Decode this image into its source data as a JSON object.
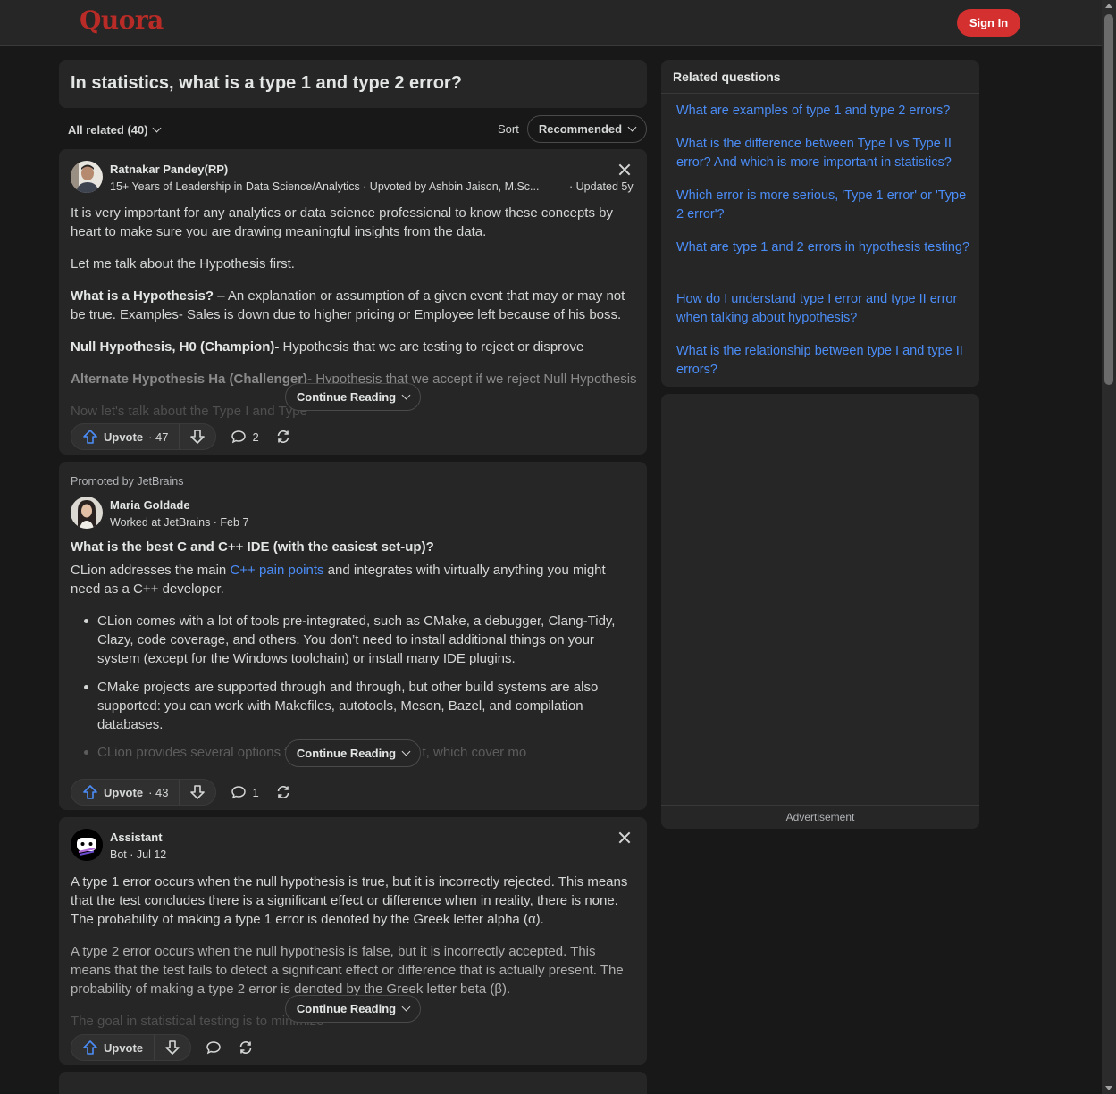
{
  "header": {
    "logo": "Quora",
    "sign_in": "Sign In"
  },
  "question": {
    "title": "In statistics, what is a type 1 and type 2 error?"
  },
  "filters": {
    "all_related": "All related (40)",
    "sort_label": "Sort",
    "sort_value": "Recommended"
  },
  "answers": [
    {
      "author": "Ratnakar Pandey(RP)",
      "credential": "15+ Years of Leadership in Data Science/Analytics · Upvoted by Ashbin Jaison, M.Sc...",
      "updated": "· Updated 5y",
      "p1": "It is very important for any analytics or data science professional to know these concepts by heart to make sure you are drawing meaningful insights from the data.",
      "p2": "Let me talk about the Hypothesis first.",
      "p3_bold": "What is a Hypothesis?",
      "p3_rest": " – An explanation or assumption of a given event that may or may not be true. Examples- Sales is down due to higher pricing or Employee left because of his boss.",
      "p4_bold": "Null Hypothesis, H0 (Champion)-",
      "p4_rest": " Hypothesis that we are testing to reject or disprove",
      "p5_bold": "Alternate Hypothesis Ha (Challenger)",
      "p5_rest": "- Hypothesis that we accept if we reject Null Hypothesis",
      "p6": "Now let's talk about the Type I and Type",
      "continue": "Continue Reading",
      "upvote": "Upvote",
      "upvote_count": "· 47",
      "comments": "2"
    },
    {
      "promoted": "Promoted by JetBrains",
      "author": "Maria Goldade",
      "credential": "Worked at JetBrains · Feb 7",
      "title": "What is the best C and C++ IDE (with the easiest set-up)?",
      "p1_pre": "CLion addresses the main ",
      "p1_link": "C++ pain points",
      "p1_post": " and integrates with virtually anything you might need as a C++ developer.",
      "b1": "CLion comes with a lot of tools pre-integrated, such as CMake, a debugger, Clang-Tidy, Clazy, code coverage, and others. You don’t need to install additional things on your system (except for the Windows toolchain) or install many IDE plugins.",
      "b2": "CMake projects are supported through and through, but other build systems are also supported: you can work with Makefiles, autotools, Meson, Bazel, and compilation databases.",
      "b3": "CLion provides several options f                                    t, which cover mo",
      "continue": "Continue Reading",
      "upvote": "Upvote",
      "upvote_count": "· 43",
      "comments": "1"
    },
    {
      "author": "Assistant",
      "credential": "Bot · Jul 12",
      "p1": "A type 1 error occurs when the null hypothesis is true, but it is incorrectly rejected. This means that the test concludes there is a significant effect or difference when in reality, there is none. The probability of making a type 1 error is denoted by the Greek letter alpha (α).",
      "p2": "A type 2 error occurs when the null hypothesis is false, but it is incorrectly accepted. This means that the test fails to detect a significant effect or difference that is actually present. The probability of making a type 2 error is denoted by the Greek letter beta (β).",
      "p3": "The goal in statistical testing is to minimize",
      "continue": "Continue Reading",
      "upvote": "Upvote"
    }
  ],
  "sidebar": {
    "heading": "Related questions",
    "links": [
      "What are examples of type 1 and type 2 errors?",
      "What is the difference between Type I vs Type II error? And which is more important in statistics?",
      "Which error is more serious, 'Type 1 error' or 'Type 2 error'?",
      "What are type 1 and 2 errors in hypothesis testing?",
      "How do I understand type I error and type II error when talking about hypothesis?",
      "What is the relationship between type I and type II errors?"
    ],
    "ad_label": "Advertisement"
  },
  "colors": {
    "brand": "#b92b27",
    "signin": "#d3302f",
    "link": "#4b8df8",
    "upvote_icon": "#4b8df8"
  }
}
